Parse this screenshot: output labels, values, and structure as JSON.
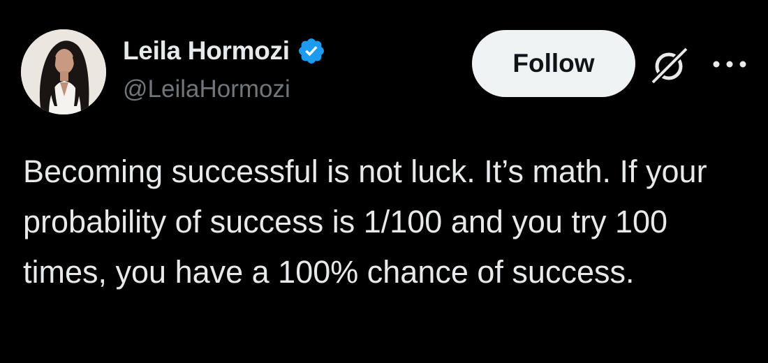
{
  "author": {
    "display_name": "Leila Hormozi",
    "handle": "@LeilaHormozi",
    "verified_icon": "verified-badge-icon",
    "avatar_icon": "profile-photo"
  },
  "actions": {
    "follow_label": "Follow",
    "grok_icon": "grok-slash-icon",
    "more_icon": "more-options-icon"
  },
  "tweet": {
    "text": "Becoming successful is not luck. It’s math. If your probability of success is 1/100 and you try 100 times, you have a 100% chance of success."
  },
  "colors": {
    "background": "#000000",
    "primary_text": "#e7e9ea",
    "secondary_text": "#71767b",
    "verified_blue": "#1d9bf0",
    "follow_bg": "#eff3f4",
    "follow_text": "#0f1419"
  }
}
